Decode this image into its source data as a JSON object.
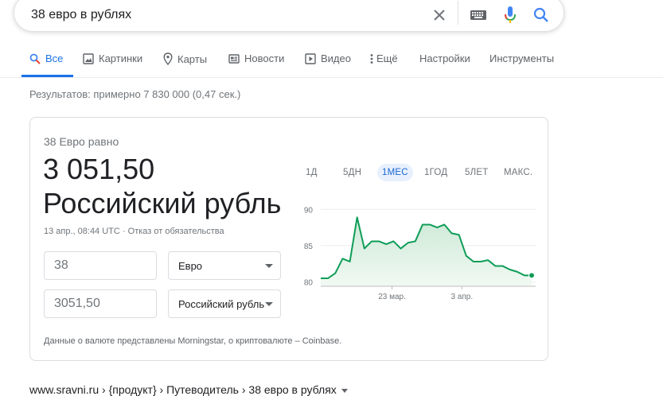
{
  "search": {
    "query": "38 евро в рублях"
  },
  "tabs": [
    {
      "label": "Все",
      "icon": "search-icon",
      "active": true
    },
    {
      "label": "Картинки",
      "icon": "image-icon"
    },
    {
      "label": "Карты",
      "icon": "map-pin-icon"
    },
    {
      "label": "Новости",
      "icon": "news-icon"
    },
    {
      "label": "Видео",
      "icon": "video-icon"
    },
    {
      "label": "Ещё",
      "icon": "more-vert-icon"
    },
    {
      "label": "Настройки"
    },
    {
      "label": "Инструменты"
    }
  ],
  "results_count": "Результатов: примерно 7 830 000 (0,47 сек.)",
  "converter": {
    "equals_label": "38 Евро равно",
    "result_value": "3 051,50",
    "result_currency": "Российский рубль",
    "timestamp": "13 апр., 08:44 UTC",
    "disclaimer": "Отказ от обязательства",
    "meta_separator": "·",
    "from_amount": "38",
    "from_currency": "Евро",
    "to_amount": "3051,50",
    "to_currency": "Российский рубль",
    "source_note": "Данные о валюте представлены Morningstar, о криптовалюте – Coinbase.",
    "ranges": [
      {
        "label": "1Д"
      },
      {
        "label": "5ДН"
      },
      {
        "label": "1МЕС",
        "active": true
      },
      {
        "label": "1ГОД"
      },
      {
        "label": "5ЛЕТ"
      },
      {
        "label": "МАКС."
      }
    ]
  },
  "colors": {
    "accent": "#1a73e8",
    "chart_line": "#0f9d58",
    "chart_fill": "#e6f4ea"
  },
  "chart_data": {
    "type": "area",
    "x": [
      0,
      1,
      2,
      3,
      4,
      5,
      6,
      7,
      8,
      9,
      10,
      11,
      12,
      13,
      14,
      15,
      16,
      17,
      18,
      19,
      20,
      21,
      22,
      23,
      24,
      25,
      26,
      27,
      28,
      29
    ],
    "values": [
      80.5,
      80.5,
      81.2,
      83.2,
      82.8,
      88.9,
      84.6,
      85.6,
      85.6,
      85.2,
      85.6,
      84.6,
      85.4,
      85.6,
      87.9,
      87.9,
      87.5,
      87.9,
      86.7,
      86.5,
      83.6,
      82.8,
      82.8,
      83.0,
      82.2,
      82.2,
      81.7,
      81.4,
      80.9,
      80.9
    ],
    "yticks": [
      80,
      85,
      90
    ],
    "ylim": [
      79.4,
      90.8
    ],
    "xtick_labels": [
      {
        "label": "23 мар.",
        "x": 9.8
      },
      {
        "label": "3 апр.",
        "x": 19.4
      }
    ],
    "grid": true
  },
  "result": {
    "breadcrumb": "www.sravni.ru › {продукт} › Путеводитель › 38 евро в рублях"
  }
}
